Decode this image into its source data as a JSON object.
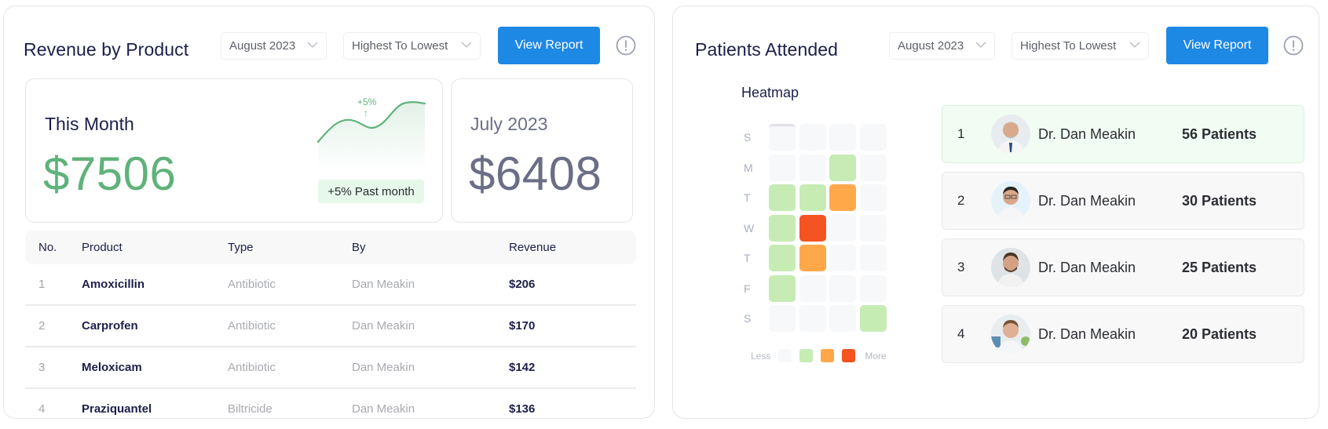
{
  "revenue_panel": {
    "title": "Revenue by Product",
    "month_dropdown": {
      "value": "August 2023"
    },
    "sort_dropdown": {
      "value": "Highest To Lowest"
    },
    "view_report_label": "View Report",
    "info_icon": "info-circle-icon",
    "this_month": {
      "label": "This Month",
      "value": "$7506",
      "trend_pct": "+5%",
      "trend_arrow": "↑",
      "badge": "+5% Past month",
      "sparkline_color": "#5fb27a"
    },
    "previous": {
      "label": "July 2023",
      "value": "$6408"
    },
    "table": {
      "columns": [
        "No.",
        "Product",
        "Type",
        "By",
        "Revenue"
      ],
      "rows": [
        {
          "no": "1",
          "product": "Amoxicillin",
          "type": "Antibiotic",
          "by": "Dan Meakin",
          "revenue": "$206"
        },
        {
          "no": "2",
          "product": "Carprofen",
          "type": "Antibiotic",
          "by": "Dan Meakin",
          "revenue": "$170"
        },
        {
          "no": "3",
          "product": "Meloxicam",
          "type": "Antibiotic",
          "by": "Dan Meakin",
          "revenue": "$142"
        },
        {
          "no": "4",
          "product": "Praziquantel",
          "type": "Biltricide",
          "by": "Dan Meakin",
          "revenue": "$136"
        }
      ]
    }
  },
  "patients_panel": {
    "title": "Patients Attended",
    "month_dropdown": {
      "value": "August 2023"
    },
    "sort_dropdown": {
      "value": "Highest To Lowest"
    },
    "view_report_label": "View Report",
    "info_icon": "info-circle-icon",
    "heatmap": {
      "title": "Heatmap",
      "row_labels": [
        "S",
        "M",
        "T",
        "W",
        "T",
        "F",
        "S"
      ],
      "levels": [
        [
          0,
          0,
          0,
          0
        ],
        [
          0,
          0,
          1,
          0
        ],
        [
          1,
          1,
          2,
          0
        ],
        [
          1,
          3,
          0,
          0
        ],
        [
          1,
          2,
          0,
          0
        ],
        [
          1,
          0,
          0,
          0
        ],
        [
          0,
          0,
          0,
          1
        ]
      ],
      "level_colors": [
        "#f7f8fa",
        "#c6ecb4",
        "#ffa84a",
        "#f55422"
      ],
      "legend_less": "Less",
      "legend_more": "More"
    },
    "doctors": [
      {
        "rank": "1",
        "name": "Dr. Dan Meakin",
        "patients": "56 Patients",
        "highlight": true
      },
      {
        "rank": "2",
        "name": "Dr. Dan Meakin",
        "patients": "30 Patients",
        "highlight": false
      },
      {
        "rank": "3",
        "name": "Dr. Dan Meakin",
        "patients": "25 Patients",
        "highlight": false
      },
      {
        "rank": "4",
        "name": "Dr. Dan Meakin",
        "patients": "20 Patients",
        "highlight": false
      }
    ]
  },
  "colors": {
    "primary": "#1e88e5",
    "title": "#1c1f4a",
    "positive": "#5fb27a",
    "muted_value": "#6b6e86"
  }
}
